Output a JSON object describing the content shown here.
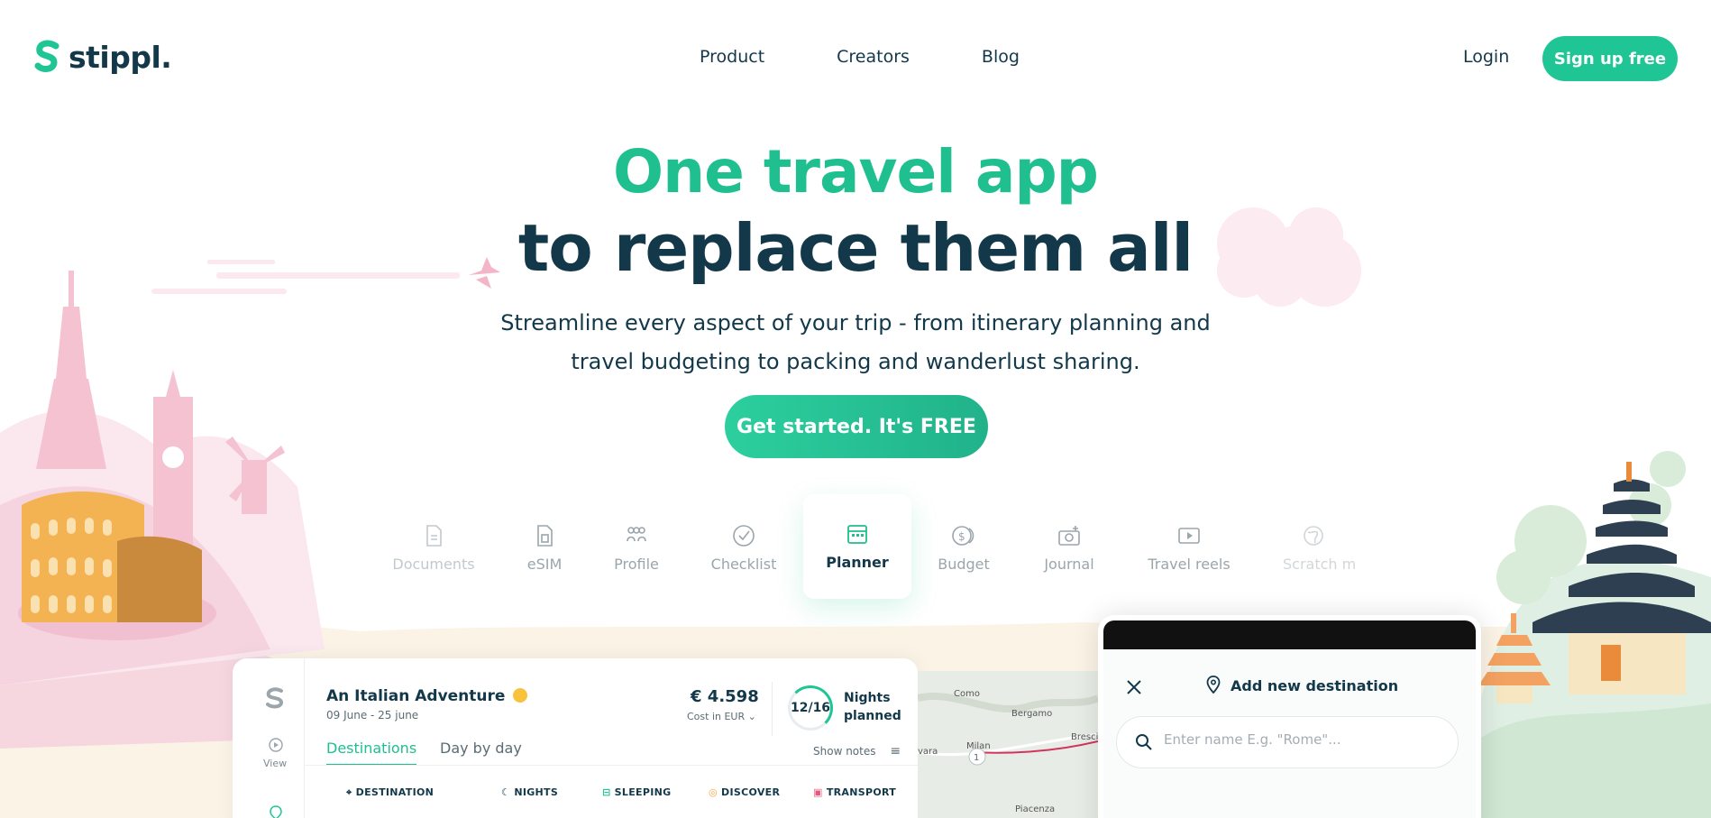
{
  "brand": {
    "name": "stippl."
  },
  "nav": {
    "links": [
      "Product",
      "Creators",
      "Blog"
    ],
    "login": "Login",
    "signup": "Sign up free"
  },
  "hero": {
    "title_line1": "One travel app",
    "title_line2": "to replace them all",
    "subtitle_line1": "Streamline every aspect of your trip - from itinerary planning and",
    "subtitle_line2": "travel budgeting to packing and wanderlust sharing.",
    "cta": "Get started. It's FREE"
  },
  "features": [
    "Documents",
    "eSIM",
    "Profile",
    "Checklist",
    "Planner",
    "Budget",
    "Journal",
    "Travel reels",
    "Scratch m"
  ],
  "active_feature": "Planner",
  "trip": {
    "title": "An Italian Adventure",
    "dates": "09 June - 25 june",
    "cost": "€ 4.598",
    "cost_label": "Cost in EUR",
    "nights": "12/16",
    "nights_label_line1": "Nights",
    "nights_label_line2": "planned",
    "tabs": [
      "Destinations",
      "Day by day"
    ],
    "show_notes": "Show notes",
    "columns": [
      "DESTINATION",
      "NIGHTS",
      "SLEEPING",
      "DISCOVER",
      "TRANSPORT"
    ],
    "side_view": "View"
  },
  "map": {
    "places": [
      "Como",
      "Bergamo",
      "Milan",
      "Bresci",
      "Piacenza",
      "vara"
    ],
    "marker": "1"
  },
  "modal": {
    "title": "Add new destination",
    "search_placeholder": "Enter name E.g. \"Rome\"..."
  },
  "colors": {
    "accent": "#1fc595",
    "dark": "#12384a",
    "pink": "#f4c6d4"
  }
}
